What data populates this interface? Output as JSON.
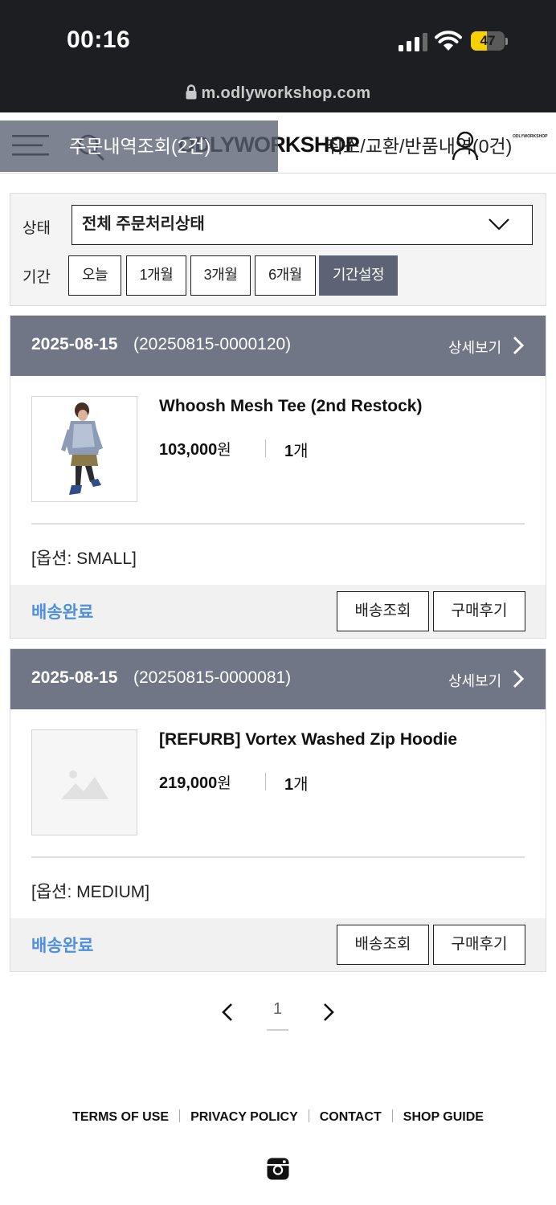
{
  "status_bar": {
    "time": "00:16",
    "battery": "47",
    "battery_level": 0.47,
    "url": "m.odlyworkshop.com"
  },
  "header": {
    "logo": "ODLYWORKSHOP",
    "mini_logo": "ODLYWORKSHOP",
    "tabs": [
      {
        "label": "주문내역조회(2건)",
        "active": true
      },
      {
        "label": "취소/교환/반품내역(0건)",
        "active": false
      }
    ]
  },
  "filter": {
    "status_label": "상태",
    "status_value": "전체 주문처리상태",
    "period_label": "기간",
    "period_buttons": [
      "오늘",
      "1개월",
      "3개월",
      "6개월",
      "기간설정"
    ],
    "period_selected": "기간설정"
  },
  "orders": [
    {
      "date": "2025-08-15",
      "order_no": "(20250815-0000120)",
      "detail_label": "상세보기",
      "product_name": "Whoosh Mesh Tee (2nd Restock)",
      "price": "103,000",
      "currency": "원",
      "qty": "1",
      "qty_unit": "개",
      "option": "[옵션: SMALL]",
      "status": "배송완료",
      "track_label": "배송조회",
      "review_label": "구매후기",
      "thumb_icon": "product-photo"
    },
    {
      "date": "2025-08-15",
      "order_no": "(20250815-0000081)",
      "detail_label": "상세보기",
      "product_name": "[REFURB] Vortex Washed Zip Hoodie",
      "price": "219,000",
      "currency": "원",
      "qty": "1",
      "qty_unit": "개",
      "option": "[옵션: MEDIUM]",
      "status": "배송완료",
      "track_label": "배송조회",
      "review_label": "구매후기",
      "thumb_icon": "image-placeholder-icon"
    }
  ],
  "pagination": {
    "current": "1"
  },
  "footer": {
    "links": [
      "TERMS OF USE",
      "PRIVACY POLICY",
      "CONTACT",
      "SHOP GUIDE"
    ],
    "social_icon": "instagram-icon"
  },
  "colors": {
    "tab_overlay": "#586072",
    "order_header": "#707685",
    "status_blue": "#4f8fe0",
    "selected_button": "#5c6374"
  }
}
